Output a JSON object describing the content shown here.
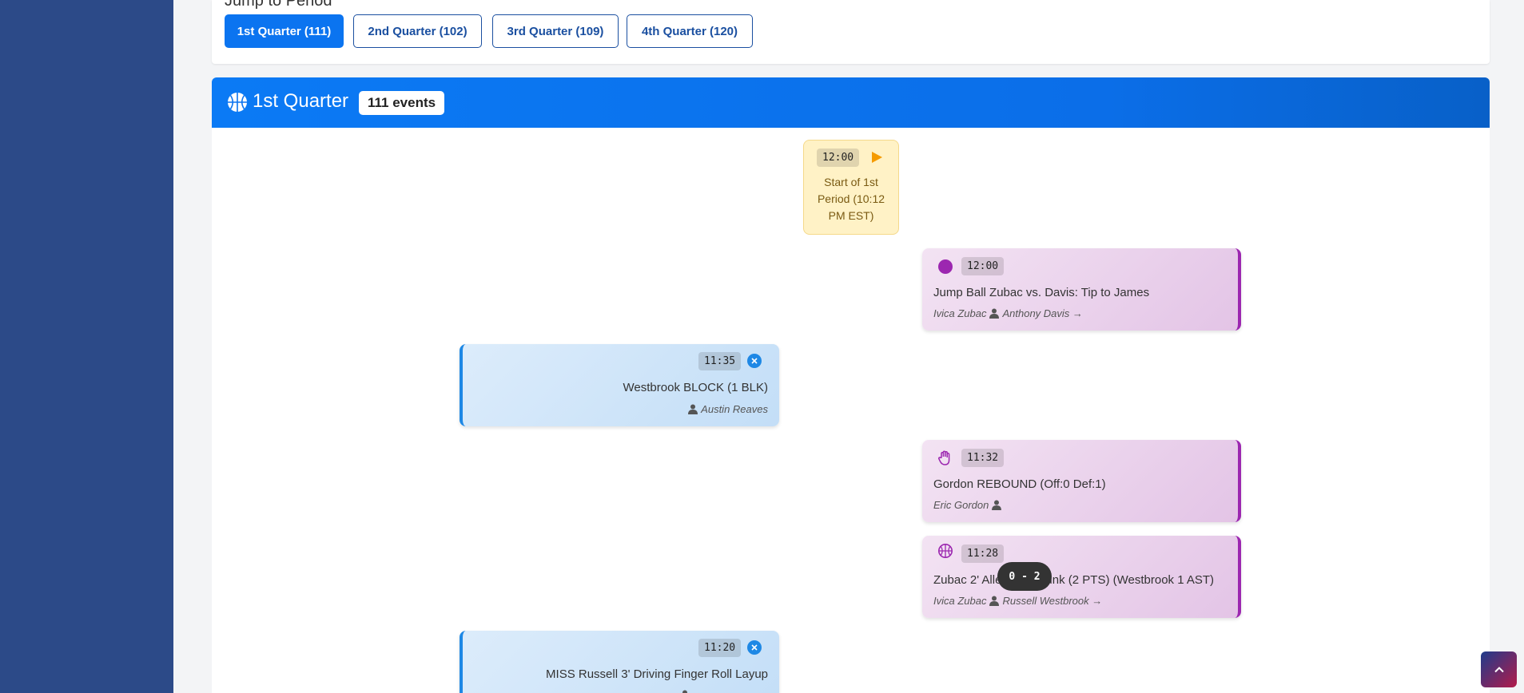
{
  "jump": {
    "title": "Jump to Period",
    "periods": [
      {
        "label": "1st Quarter (111)",
        "active": true
      },
      {
        "label": "2nd Quarter (102)",
        "active": false
      },
      {
        "label": "3rd Quarter (109)",
        "active": false
      },
      {
        "label": "4th Quarter (120)",
        "active": false
      }
    ]
  },
  "quarter": {
    "title": "1st Quarter",
    "badge": "111 events",
    "header_color": "#0b74f0"
  },
  "events": [
    {
      "type": "start",
      "time": "12:00",
      "icon": "play-icon",
      "lines": [
        "Start of 1st",
        "Period (10:12",
        "PM EST)"
      ]
    },
    {
      "type": "home",
      "time": "12:00",
      "icon": "circle-icon",
      "desc": "Jump Ball Zubac vs. Davis: Tip to James",
      "player1": "Ivica Zubac",
      "player2": "Anthony Davis →"
    },
    {
      "type": "away",
      "time": "11:35",
      "icon": "x-circle-icon",
      "desc": "Westbrook BLOCK (1 BLK)",
      "player2": "Austin Reaves"
    },
    {
      "type": "home",
      "time": "11:32",
      "icon": "hand-icon",
      "desc": "Gordon REBOUND (Off:0 Def:1)",
      "player1": "Eric Gordon",
      "player2": ""
    },
    {
      "type": "home",
      "time": "11:28",
      "icon": "basketball-icon",
      "desc": "Zubac 2' Alley Oop Dunk (2 PTS) (Westbrook 1 AST)",
      "player1": "Ivica Zubac",
      "player2": "Russell Westbrook →"
    },
    {
      "type": "away",
      "time": "11:20",
      "icon": "x-circle-icon",
      "desc": "MISS Russell 3' Driving Finger Roll Layup"
    }
  ],
  "score": "0 - 2",
  "colors": {
    "home": "#9c27b0",
    "away": "#1e88e5",
    "start": "#fff2c6",
    "sidebar": "#2c4a88"
  }
}
